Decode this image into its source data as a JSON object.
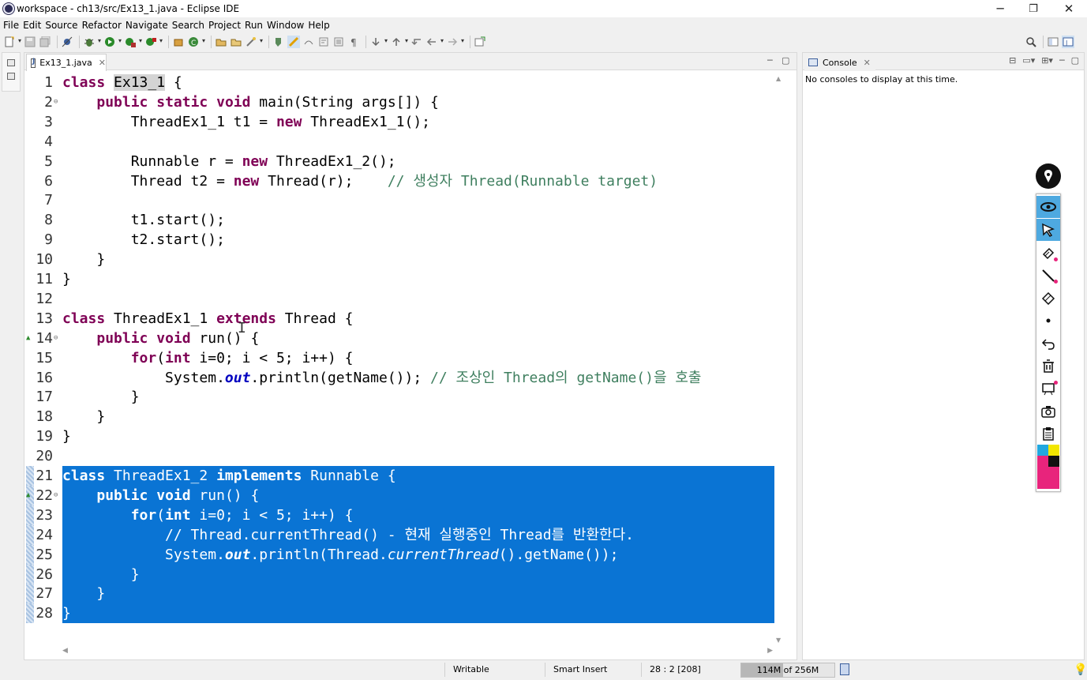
{
  "window": {
    "title": "workspace - ch13/src/Ex13_1.java - Eclipse IDE",
    "controls": {
      "minimize": "─",
      "maximize": "❐",
      "close": "✕"
    }
  },
  "menu": [
    "File",
    "Edit",
    "Source",
    "Refactor",
    "Navigate",
    "Search",
    "Project",
    "Run",
    "Window",
    "Help"
  ],
  "editor": {
    "tab_label": "Ex13_1.java",
    "tab_close": "✕",
    "lines": [
      {
        "n": "1",
        "text": "class Ex13_1 {"
      },
      {
        "n": "2",
        "text": "    public static void main(String args[]) {",
        "fold": true
      },
      {
        "n": "3",
        "text": "        ThreadEx1_1 t1 = new ThreadEx1_1();"
      },
      {
        "n": "4",
        "text": ""
      },
      {
        "n": "5",
        "text": "        Runnable r = new ThreadEx1_2();"
      },
      {
        "n": "6",
        "text": "        Thread t2 = new Thread(r);    // 생성자 Thread(Runnable target)"
      },
      {
        "n": "7",
        "text": ""
      },
      {
        "n": "8",
        "text": "        t1.start();"
      },
      {
        "n": "9",
        "text": "        t2.start();"
      },
      {
        "n": "10",
        "text": "    }"
      },
      {
        "n": "11",
        "text": "}"
      },
      {
        "n": "12",
        "text": ""
      },
      {
        "n": "13",
        "text": "class ThreadEx1_1 extends Thread {"
      },
      {
        "n": "14",
        "text": "    public void run() {",
        "fold": true,
        "override": true
      },
      {
        "n": "15",
        "text": "        for(int i=0; i < 5; i++) {"
      },
      {
        "n": "16",
        "text": "            System.out.println(getName()); // 조상인 Thread의 getName()을 호출"
      },
      {
        "n": "17",
        "text": "        }"
      },
      {
        "n": "18",
        "text": "    }"
      },
      {
        "n": "19",
        "text": "}"
      },
      {
        "n": "20",
        "text": ""
      },
      {
        "n": "21",
        "text": "class ThreadEx1_2 implements Runnable {",
        "selected": true
      },
      {
        "n": "22",
        "text": "    public void run() {",
        "fold": true,
        "override": true,
        "selected": true
      },
      {
        "n": "23",
        "text": "        for(int i=0; i < 5; i++) {",
        "selected": true
      },
      {
        "n": "24",
        "text": "            // Thread.currentThread() - 현재 실행중인 Thread를 반환한다.",
        "selected": true
      },
      {
        "n": "25",
        "text": "            System.out.println(Thread.currentThread().getName());",
        "selected": true
      },
      {
        "n": "26",
        "text": "        }",
        "selected": true
      },
      {
        "n": "27",
        "text": "    }",
        "selected": true
      },
      {
        "n": "28",
        "text": "}",
        "selected": true
      }
    ]
  },
  "console": {
    "tab_label": "Console",
    "tab_close": "✕",
    "message": "No consoles to display at this time."
  },
  "status": {
    "writable": "Writable",
    "insert_mode": "Smart Insert",
    "position": "28 : 2 [208]",
    "heap_label": "114M of 256M",
    "heap_used_fraction": 0.445
  },
  "colors": {
    "selection": "#0a74d4",
    "keyword": "#7f0055",
    "comment": "#3f7f5f",
    "field": "#0000c0"
  },
  "annotation_tools": [
    "logo-icon",
    "eye-icon",
    "pointer-icon",
    "highlighter-icon",
    "pen-icon",
    "eraser-icon",
    "dot-icon",
    "undo-icon",
    "trash-icon",
    "whiteboard-icon",
    "camera-icon",
    "clipboard-icon"
  ]
}
